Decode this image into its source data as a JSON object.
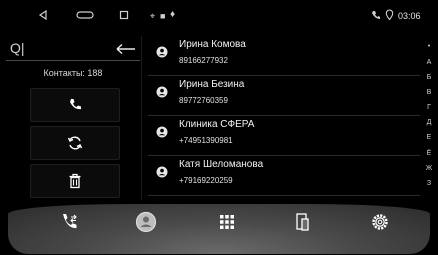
{
  "status_bar": {
    "icons_left": [
      "back-icon",
      "home-icon",
      "recents-icon"
    ],
    "notification_icons": [
      "gps-icon",
      "bluetooth-icon",
      "usb-icon"
    ],
    "time": "03:06",
    "right_icons": [
      "call-icon",
      "location-icon"
    ]
  },
  "left_panel": {
    "search_value": "",
    "contacts_count": "Контакты: 188",
    "buttons": [
      "phone-icon",
      "sync-icon",
      "trash-icon"
    ]
  },
  "contacts": [
    {
      "name": "Ирина Комова",
      "phone": "89166277932"
    },
    {
      "name": "Ирина Безина",
      "phone": "89772760359"
    },
    {
      "name": "Клиника СФЕРА",
      "phone": "+74951390981"
    },
    {
      "name": "Катя Шеломанова",
      "phone": "+79169220259"
    }
  ],
  "alphabet_index": [
    "•",
    "А",
    "Б",
    "В",
    "Г",
    "Д",
    "Е",
    "Ё",
    "Ж",
    "З"
  ],
  "dock": {
    "items": [
      "call-transfer-icon",
      "contacts-icon",
      "dialpad-icon",
      "device-icon",
      "settings-icon"
    ],
    "active_index": 1
  },
  "colors": {
    "background": "#000000",
    "dock": "#4a4a4a",
    "active": "#bdbdbd"
  }
}
